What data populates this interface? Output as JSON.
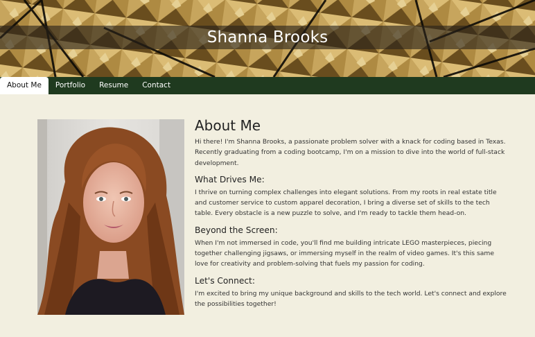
{
  "header": {
    "site_title": "Shanna Brooks",
    "banner_image": "gold-pyramid-pattern"
  },
  "nav": {
    "items": [
      {
        "label": "About Me",
        "active": true
      },
      {
        "label": "Portfolio",
        "active": false
      },
      {
        "label": "Resume",
        "active": false
      },
      {
        "label": "Contact",
        "active": false
      }
    ]
  },
  "main": {
    "photo": "portrait-photo",
    "heading": "About Me",
    "intro": "Hi there! I'm Shanna Brooks, a passionate problem solver with a knack for coding based in Texas. Recently graduating from a coding bootcamp, I'm on a mission to dive into the world of full-stack development.",
    "sections": [
      {
        "heading": "What Drives Me:",
        "text": "I thrive on turning complex challenges into elegant solutions. From my roots in real estate title and customer service to custom apparel decoration, I bring a diverse set of skills to the tech table. Every obstacle is a new puzzle to solve, and I'm ready to tackle them head-on."
      },
      {
        "heading": "Beyond the Screen:",
        "text": "When I'm not immersed in code, you'll find me building intricate LEGO masterpieces, piecing together challenging jigsaws, or immersing myself in the realm of video games. It's this same love for creativity and problem-solving that fuels my passion for coding."
      },
      {
        "heading": "Let's Connect:",
        "text": "I'm excited to bring my unique background and skills to the tech world. Let's connect and explore the possibilities together!"
      }
    ]
  },
  "colors": {
    "page_background": "#f2efe0",
    "nav_background": "#1f3a1f",
    "banner_gold": "#c9a24e"
  }
}
